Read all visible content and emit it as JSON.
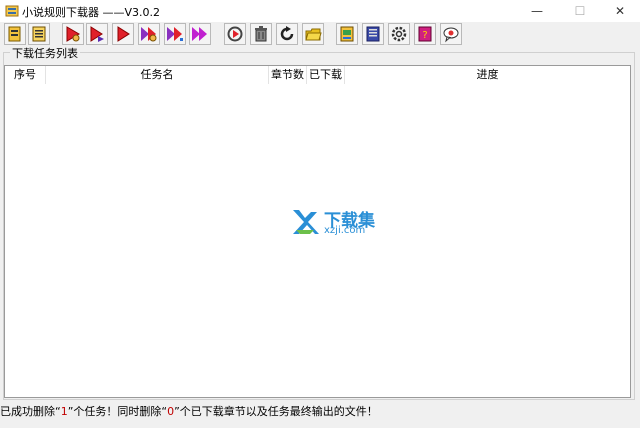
{
  "window": {
    "title": "小说规则下载器  ——V3.0.2",
    "min_glyph": "—",
    "max_glyph": "☐",
    "close_glyph": "✕"
  },
  "toolbar": {
    "buttons": [
      {
        "name": "add-task-button",
        "icon": "add-book-icon"
      },
      {
        "name": "book-list-button",
        "icon": "book-list-icon"
      },
      {
        "name": "start-selected-button",
        "icon": "play-gear-icon"
      },
      {
        "name": "start-next-button",
        "icon": "play-step-icon"
      },
      {
        "name": "start-button",
        "icon": "play-icon"
      },
      {
        "name": "start-all-button",
        "icon": "double-play-gear-icon"
      },
      {
        "name": "start-all-fast-button",
        "icon": "double-play-icon"
      },
      {
        "name": "resume-all-button",
        "icon": "fast-forward-icon"
      },
      {
        "name": "restart-button",
        "icon": "replay-icon"
      },
      {
        "name": "delete-button",
        "icon": "trash-icon"
      },
      {
        "name": "refresh-button",
        "icon": "refresh-icon"
      },
      {
        "name": "open-folder-button",
        "icon": "folder-icon"
      },
      {
        "name": "rules-button",
        "icon": "rules-icon"
      },
      {
        "name": "notes-button",
        "icon": "notebook-icon"
      },
      {
        "name": "settings-button",
        "icon": "gear-icon"
      },
      {
        "name": "help-button",
        "icon": "help-book-icon"
      },
      {
        "name": "about-button",
        "icon": "speech-bubble-icon"
      }
    ]
  },
  "task_list": {
    "group_label": "下载任务列表",
    "columns": [
      "序号",
      "任务名",
      "章节数",
      "已下载",
      "进度"
    ],
    "rows": []
  },
  "watermark": {
    "cn_text": "下载集",
    "domain": "xzji.com"
  },
  "status_bar": {
    "prefix": "已成功删除“",
    "deleted_tasks": "1",
    "middle": "”个任务！同时删除“",
    "deleted_chapters": "0",
    "suffix": "”个已下载章节以及任务最终输出的文件！"
  },
  "colors": {
    "accent_play": "#e0202a",
    "folder": "#e8c020",
    "watermark": "#2a8fd6"
  }
}
